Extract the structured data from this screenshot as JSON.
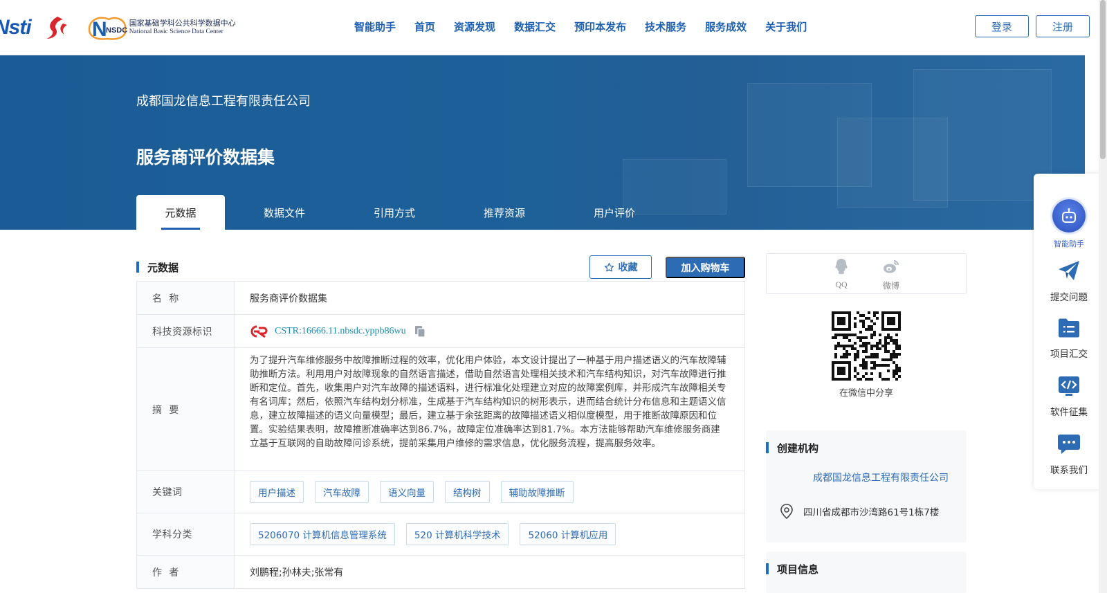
{
  "brand": {
    "logo_nstl": "Nsti",
    "nsdc_abbr": "NSDC",
    "nsdc_cn": "国家基础学科公共科学数据中心",
    "nsdc_en": "National Basic Science Data Center"
  },
  "nav": {
    "items": [
      "智能助手",
      "首页",
      "资源发现",
      "数据汇交",
      "预印本发布",
      "技术服务",
      "服务成效",
      "关于我们"
    ]
  },
  "auth": {
    "login": "登录",
    "register": "注册"
  },
  "banner": {
    "org": "成都国龙信息工程有限责任公司",
    "title": "服务商评价数据集",
    "tabs": [
      "元数据",
      "数据文件",
      "引用方式",
      "推荐资源",
      "用户评价"
    ]
  },
  "metadata": {
    "section_title": "元数据",
    "favorite_label": "收藏",
    "cart_label": "加入购物车",
    "rows": {
      "name_label": "名  称",
      "name_value": "服务商评价数据集",
      "id_label": "科技资源标识",
      "id_value": "CSTR:16666.11.nbsdc.yppb86wu",
      "abstract_label": "摘  要",
      "abstract_value": "为了提升汽车维修服务中故障推断过程的效率，优化用户体验，本文设计提出了一种基于用户描述语义的汽车故障辅助推断方法。利用用户对故障现象的自然语言描述，借助自然语言处理相关技术和汽车结构知识，对汽车故障进行推断和定位。首先，收集用户对汽车故障的描述语料，进行标准化处理建立对应的故障案例库，并形成汽车故障相关专有名词库；然后，依照汽车结构划分标准，生成基于汽车结构知识的树形表示，进而结合统计分布信息和主题语义信息，建立故障描述的语义向量模型；最后，建立基于余弦距离的故障描述语义相似度模型，用于推断故障原因和位置。实验结果表明，故障推断准确率达到86.7%，故障定位准确率达到81.7%。本方法能够帮助汽车维修服务商建立基于互联网的自助故障问诊系统，提前采集用户维修的需求信息，优化服务流程，提高服务效率。",
      "keywords_label": "关键词",
      "keywords": [
        "用户描述",
        "汽车故障",
        "语义向量",
        "结构树",
        "辅助故障推断"
      ],
      "subject_label": "学科分类",
      "subjects": [
        "5206070 计算机信息管理系统",
        "520 计算机科学技术",
        "52060 计算机应用"
      ],
      "author_label": "作  者",
      "author_value": "刘鹏程;孙林夫;张常有"
    }
  },
  "share": {
    "qq": "QQ",
    "weibo": "微博",
    "wechat_caption": "在微信中分享"
  },
  "creator": {
    "title": "创建机构",
    "org": "成都国龙信息工程有限责任公司",
    "address": "四川省成都市沙湾路61号1栋7楼"
  },
  "project": {
    "title": "项目信息"
  },
  "side_tools": {
    "assistant": "智能助手",
    "submit": "提交问题",
    "project": "项目汇交",
    "software": "软件征集",
    "contact": "联系我们"
  },
  "colors": {
    "primary": "#2e6bb5",
    "banner": "#1d6099",
    "accent_bar": "#1d6fc4",
    "link_teal": "#1b8db0"
  }
}
